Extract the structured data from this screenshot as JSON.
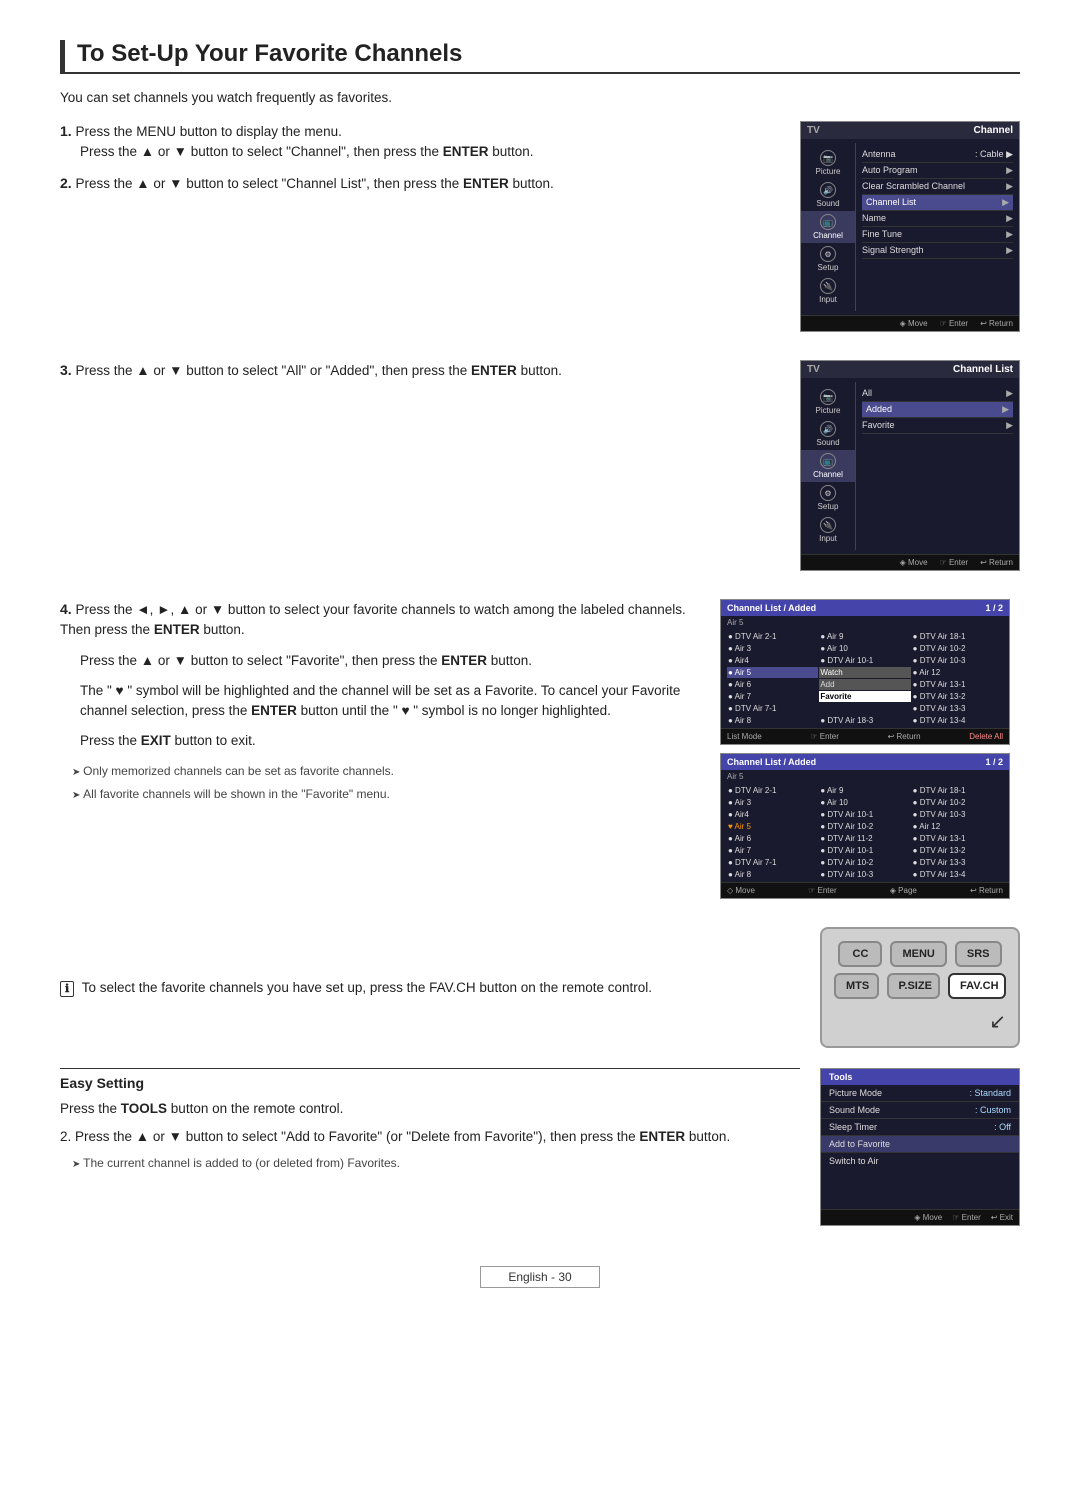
{
  "page": {
    "title": "To Set-Up Your Favorite Channels",
    "intro": "You can set channels you watch frequently as favorites.",
    "footer": "English - 30"
  },
  "steps": {
    "step1_num": "1.",
    "step1_line1": "Press the MENU button to display the menu.",
    "step1_line2_pre": "Press the ▲ or ▼ button to select \"Channel\", then press the ",
    "step1_line2_enter": "ENTER",
    "step1_line2_post": " button.",
    "step2_line1_pre": "Press the ▲ or ▼ button to select \"Channel List\", then press the ",
    "step2_line1_enter": "ENTER",
    "step2_line1_post": " button.",
    "step2_num": "2.",
    "step3_num": "3.",
    "step3_text_pre": "Press the ▲ or ▼ button to select \"All\" or \"Added\", then press the ",
    "step3_enter": "ENTER",
    "step3_post": " button.",
    "step4_num": "4.",
    "step4_line1": "Press the ◄, ►, ▲ or ▼ button to select your favorite channels to watch among the labeled channels. Then press the ",
    "step4_enter1": "ENTER",
    "step4_post1": " button.",
    "step4_line2_pre": "Press the ▲ or ▼ button to select \"Favorite\", then press the ",
    "step4_enter2": "ENTER",
    "step4_post2": " button.",
    "step4_line3_pre": "The \" ♥ \" symbol will be highlighted and the channel will be set as a Favorite. To cancel your Favorite channel selection, press the ",
    "step4_enter3": "ENTER",
    "step4_post3": " button until the \" ♥ \" symbol is no longer highlighted.",
    "step4_exit": "Press the EXIT button to exit.",
    "note1": "Only memorized channels can be set as favorite channels.",
    "note2": "All favorite channels will be shown in the \"Favorite\" menu."
  },
  "remote_section": {
    "info_text": "To select the favorite channels you have set up, press the FAV.CH button on the remote control.",
    "buttons": {
      "row1": [
        "CC",
        "MENU",
        "SRS"
      ],
      "row2": [
        "MTS",
        "P.SIZE",
        "FAV.CH"
      ]
    }
  },
  "easy_setting": {
    "title": "Easy Setting",
    "step1": "1. Press the TOOLS button on the remote control.",
    "step2_pre": "2. Press the ▲ or ▼ button to select \"Add to Favorite\" (or \"Delete from Favorite\"), then press the ",
    "step2_enter": "ENTER",
    "step2_post": " button.",
    "note": "The current channel is added to (or deleted from) Favorites."
  },
  "menus": {
    "menu1": {
      "header_left": "TV",
      "header_right": "Channel",
      "sidebar": [
        {
          "icon": "📷",
          "label": "Picture"
        },
        {
          "icon": "🔊",
          "label": "Sound"
        },
        {
          "icon": "📺",
          "label": "Channel",
          "active": true
        },
        {
          "icon": "⚙",
          "label": "Setup"
        },
        {
          "icon": "🔌",
          "label": "Input"
        }
      ],
      "rows": [
        {
          "label": "Antenna",
          "value": ": Cable"
        },
        {
          "label": "Auto Program",
          "value": "▶"
        },
        {
          "label": "Clear Scrambled Channel",
          "value": "▶"
        },
        {
          "label": "Channel List",
          "value": "▶",
          "highlight": true
        },
        {
          "label": "Name",
          "value": "▶"
        },
        {
          "label": "Fine Tune",
          "value": "▶"
        },
        {
          "label": "Signal Strength",
          "value": "▶"
        }
      ],
      "footer": [
        "◈ Move",
        "☞ Enter",
        "↩ Return"
      ]
    },
    "menu2": {
      "header_left": "TV",
      "header_right": "Channel List",
      "rows": [
        {
          "label": "All",
          "value": "▶"
        },
        {
          "label": "Added",
          "value": "▶"
        },
        {
          "label": "Favorite",
          "value": "▶"
        }
      ],
      "footer": [
        "◈ Move",
        "☞ Enter",
        "↩ Return"
      ]
    },
    "menu3": {
      "header": "Channel List / Added",
      "page": "1 / 2",
      "air": "Air 5",
      "channels_col1": [
        "DTV Air 2-1",
        "Air 3",
        "Air 4",
        "Air 5",
        "Air 6",
        "Air 7",
        "DTV Air 7-1",
        "Air 8"
      ],
      "channels_col2": [
        "Air 9",
        "Air 10",
        "DTV Air 10-1",
        "DTV Air 10-2",
        "Watch",
        "Add",
        "Favorite"
      ],
      "channels_col3": [
        "DTV Air 18-1",
        "DTV Air 10-2",
        "DTV Air 10-3",
        "Air 12",
        "DTV Air 13-1",
        "DTV Air 13-2",
        "DTV Air 13-3",
        "DTV Air 13-4"
      ],
      "footer": [
        "List Mode",
        "☞ Enter",
        "↩ Return",
        "Delete All"
      ]
    },
    "menu4": {
      "header": "Channel List / Added",
      "page": "1 / 2",
      "air": "Air 5",
      "footer": [
        "◇ Move",
        "☞ Enter",
        "◈ Page",
        "↩ Return"
      ]
    },
    "tools_menu": {
      "header": "Tools",
      "rows": [
        {
          "label": "Picture Mode",
          "value": ": Standard"
        },
        {
          "label": "Sound Mode",
          "value": ": Custom"
        },
        {
          "label": "Sleep Timer",
          "value": ": Off"
        },
        {
          "label": "Add to Favorite",
          "value": ""
        },
        {
          "label": "Switch to Air",
          "value": ""
        }
      ],
      "footer": [
        "◈ Move",
        "☞ Enter",
        "↩ Exit"
      ]
    }
  }
}
